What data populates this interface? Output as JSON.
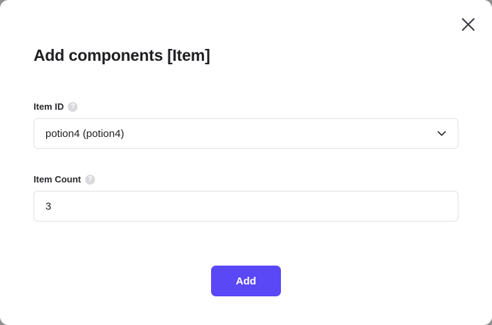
{
  "dialog": {
    "title": "Add components [Item]",
    "close_icon": "close-icon"
  },
  "fields": {
    "item_id": {
      "label": "Item ID",
      "help_icon": "help-icon",
      "help_glyph": "?",
      "selected_value": "potion4 (potion4)",
      "dropdown_icon": "chevron-down-icon"
    },
    "item_count": {
      "label": "Item Count",
      "help_icon": "help-icon",
      "help_glyph": "?",
      "value": "3"
    }
  },
  "actions": {
    "add_label": "Add"
  },
  "colors": {
    "accent": "#5a47f5",
    "border": "#e1e1e6",
    "text": "#1f1f23"
  }
}
